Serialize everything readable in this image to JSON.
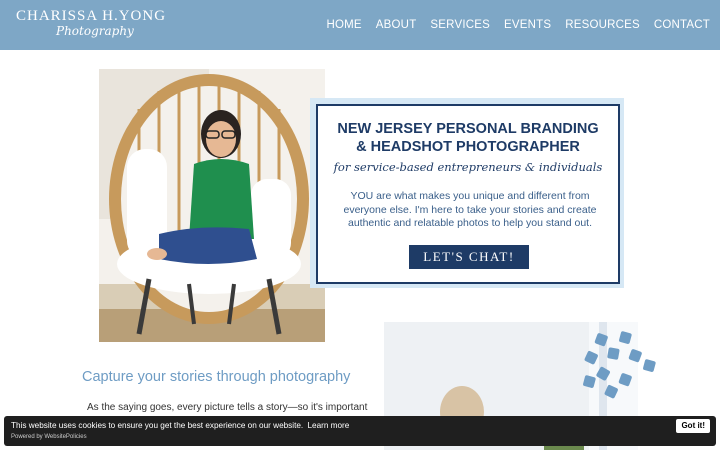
{
  "header": {
    "logo_main": "CHARISSA H.YONG",
    "logo_script": "Photography",
    "nav": [
      "HOME",
      "ABOUT",
      "SERVICES",
      "EVENTS",
      "RESOURCES",
      "CONTACT"
    ]
  },
  "hero": {
    "title_line1": "NEW JERSEY PERSONAL BRANDING",
    "title_line2": "& HEADSHOT PHOTOGRAPHER",
    "subtitle": "for service-based entrepreneurs & individuals",
    "body": "YOU are what makes you unique and different from everyone else. I'm here to take your stories and create authentic and relatable photos to help you stand out.",
    "cta_label": "LET'S CHAT!"
  },
  "section": {
    "heading": "Capture your stories through photography",
    "text": "As the saying goes, every picture tells a story—so it's important"
  },
  "cookie": {
    "message": "This website uses cookies to ensure you get the best experience on our website.",
    "learn_more": "Learn more",
    "powered_by": "Powered by WebsitePolicies",
    "accept_label": "Got it!"
  },
  "colors": {
    "header_bg": "#7ea7c6",
    "navy": "#1e3b66",
    "accent_blue": "#6e9cc4",
    "card_frame": "#d6e8f5"
  }
}
